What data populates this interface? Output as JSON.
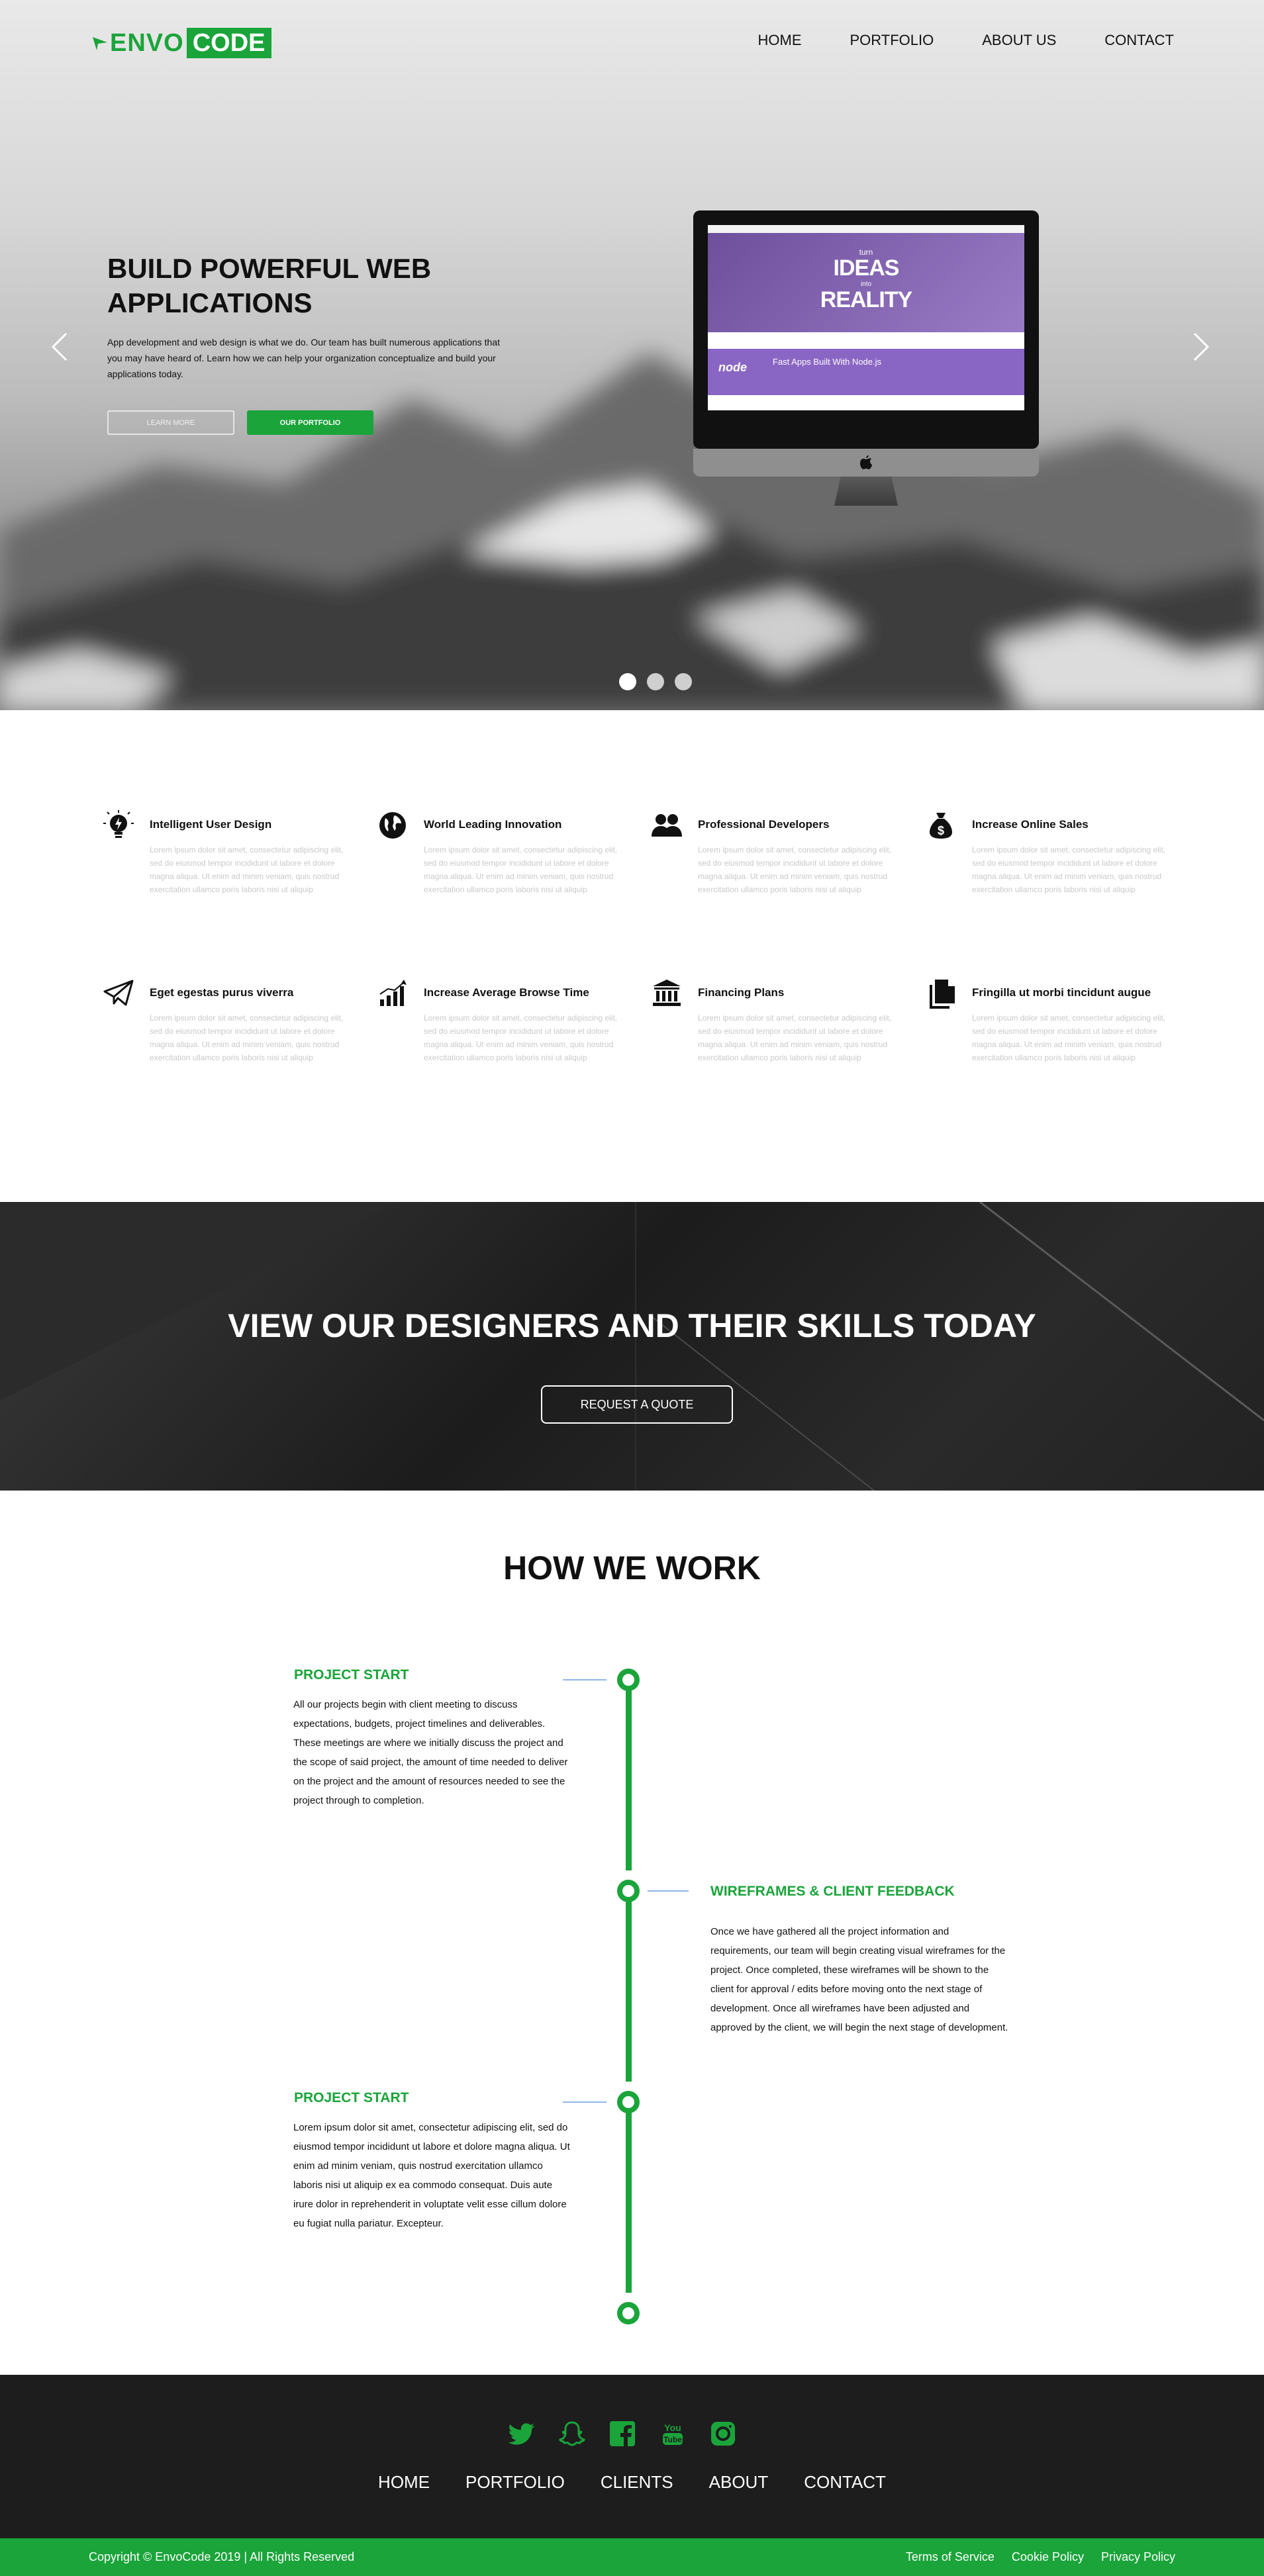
{
  "brand": {
    "name_part1": "ENVO",
    "name_part2": "CODE",
    "green": "#1aa43a",
    "dark": "#1d1d1d"
  },
  "nav": {
    "items": [
      "HOME",
      "PORTFOLIO",
      "ABOUT US",
      "CONTACT"
    ]
  },
  "hero": {
    "title": "BUILD POWERFUL WEB APPLICATIONS",
    "subtitle": "App development and web design is what we do. Our team has built numerous applications that you may have heard of. Learn how we can help your organization conceptualize and build your applications today.",
    "learn_more": "LEARN MORE",
    "portfolio": "OUR PORTFOLIO",
    "prev_icon": "chevron-left-icon",
    "next_icon": "chevron-right-icon",
    "slide_count": 3,
    "active_slide": 1,
    "screen": {
      "small1": "turn",
      "big1": "IDEAS",
      "small2": "into",
      "big2": "REALITY",
      "node_logo": "node",
      "node_title": "Fast Apps Built With Node.js"
    }
  },
  "features": [
    {
      "icon": "lightbulb-icon",
      "title": "Intelligent User Design",
      "text": "Lorem ipsum dolor sit amet, consectetur adipiscing elit, sed do eiusmod tempor incididunt ut labore et dolore magna aliqua. Ut enim ad minim veniam, quis nostrud exercitation ullamco poris laboris nisi ut aliquip"
    },
    {
      "icon": "globe-icon",
      "title": "World Leading Innovation",
      "text": "Lorem ipsum dolor sit amet, consectetur adipiscing elit, sed do eiusmod tempor incididunt ut labore et dolore magna aliqua. Ut enim ad minim veniam, quis nostrud exercitation ullamco poris laboris nisi ut aliquip"
    },
    {
      "icon": "users-icon",
      "title": "Professional Developers",
      "text": "Lorem ipsum dolor sit amet, consectetur adipiscing elit, sed do eiusmod tempor incididunt ut labore et dolore magna aliqua. Ut enim ad minim veniam, quis nostrud exercitation ullamco poris laboris nisi ut aliquip"
    },
    {
      "icon": "money-bag-icon",
      "title": "Increase Online Sales",
      "text": "Lorem ipsum dolor sit amet, consectetur adipiscing elit, sed do eiusmod tempor incididunt ut labore et dolore magna aliqua. Ut enim ad minim veniam, quis nostrud exercitation ullamco poris laboris nisi ut aliquip"
    },
    {
      "icon": "paper-plane-icon",
      "title": "Eget egestas purus viverra",
      "text": "Lorem ipsum dolor sit amet, consectetur adipiscing elit, sed do eiusmod tempor incididunt ut labore et dolore magna aliqua. Ut enim ad minim veniam, quis nostrud exercitation ullamco poris laboris nisi ut aliquip"
    },
    {
      "icon": "bar-chart-icon",
      "title": "Increase Average Browse Time",
      "text": "Lorem ipsum dolor sit amet, consectetur adipiscing elit, sed do eiusmod tempor incididunt ut labore et dolore magna aliqua. Ut enim ad minim veniam, quis nostrud exercitation ullamco poris laboris nisi ut aliquip"
    },
    {
      "icon": "bank-icon",
      "title": "Financing Plans",
      "text": "Lorem ipsum dolor sit amet, consectetur adipiscing elit, sed do eiusmod tempor incididunt ut labore et dolore magna aliqua. Ut enim ad minim veniam, quis nostrud exercitation ullamco poris laboris nisi ut aliquip"
    },
    {
      "icon": "documents-icon",
      "title": "Fringilla ut morbi tincidunt augue",
      "text": "Lorem ipsum dolor sit amet, consectetur adipiscing elit, sed do eiusmod tempor incididunt ut labore et dolore magna aliqua. Ut enim ad minim veniam, quis nostrud exercitation ullamco poris laboris nisi ut aliquip"
    }
  ],
  "cta": {
    "title": "VIEW OUR DESIGNERS AND THEIR SKILLS TODAY",
    "button": "REQUEST A QUOTE"
  },
  "how_we_work": {
    "title": "HOW WE WORK",
    "steps": [
      {
        "heading": "PROJECT START",
        "text": "All our projects begin with client meeting to discuss expectations, budgets, project timelines and deliverables. These meetings are where we initially discuss the project and the scope of said project, the amount of time needed to deliver on the project and the amount of resources needed to see the project through to completion."
      },
      {
        "heading": "WIREFRAMES & CLIENT FEEDBACK",
        "text": "Once we have gathered all the project information and requirements, our team will begin creating visual wireframes for the project. Once completed, these wireframes will be shown to the client for approval / edits before moving onto the next stage of development. Once all wireframes have been adjusted and approved by the client, we will begin the next stage of development."
      },
      {
        "heading": "PROJECT START",
        "text": "Lorem ipsum dolor sit amet, consectetur adipiscing elit, sed do eiusmod tempor incididunt ut labore et dolore magna aliqua. Ut enim ad minim veniam, quis nostrud exercitation ullamco laboris nisi ut aliquip ex ea commodo consequat. Duis aute irure dolor in reprehenderit in voluptate velit esse cillum dolore eu fugiat nulla pariatur. Excepteur."
      }
    ]
  },
  "footer": {
    "socials": [
      "twitter-icon",
      "snapchat-icon",
      "facebook-icon",
      "youtube-icon",
      "instagram-icon"
    ],
    "nav": [
      "HOME",
      "PORTFOLIO",
      "CLIENTS",
      "ABOUT",
      "CONTACT"
    ],
    "copyright": "Copyright © EnvoCode 2019 | All Rights Reserved",
    "legal": [
      "Terms of Service",
      "Cookie Policy",
      "Privacy Policy"
    ]
  }
}
